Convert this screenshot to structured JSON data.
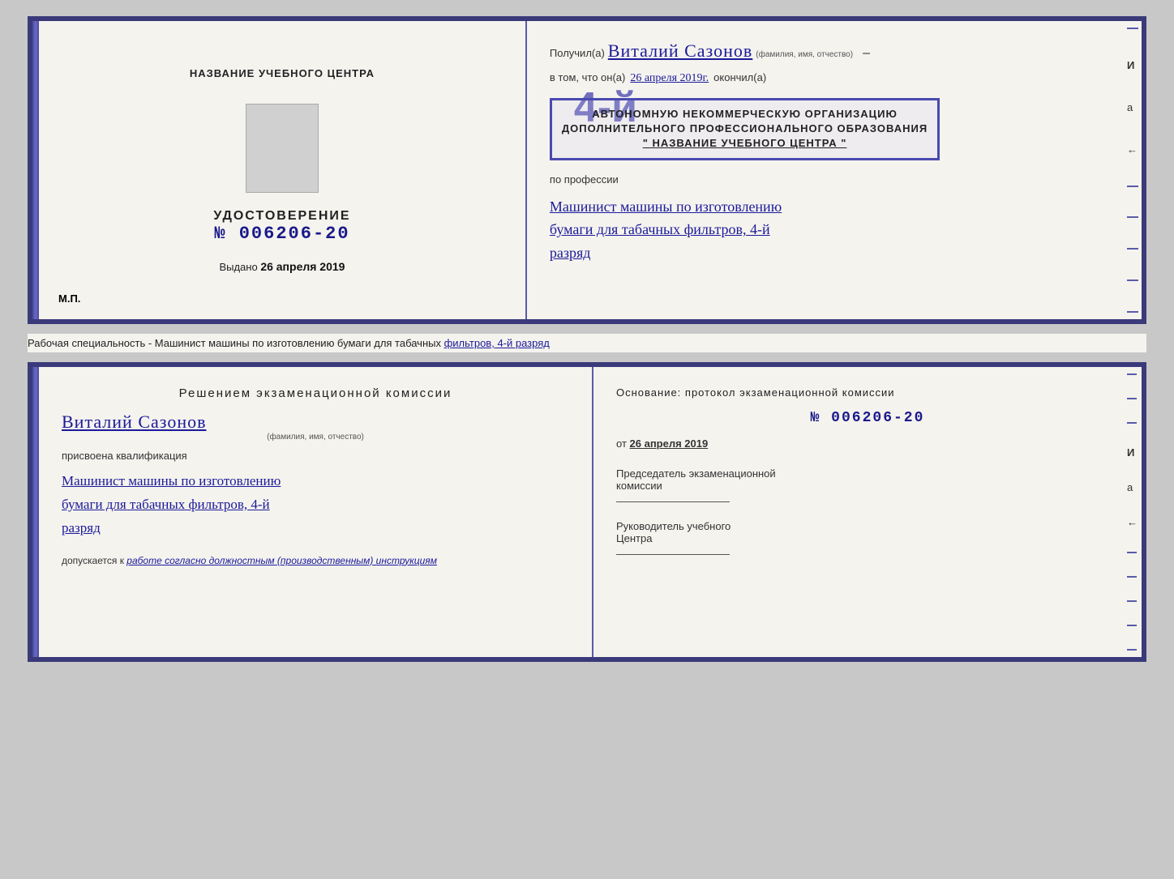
{
  "top_cert": {
    "left": {
      "header": "НАЗВАНИЕ УЧЕБНОГО ЦЕНТРА",
      "udostoverenie_label": "УДОСТОВЕРЕНИЕ",
      "number": "№ 006206-20",
      "vydano_label": "Выдано",
      "vydano_date": "26 апреля 2019",
      "mp_label": "М.П."
    },
    "right": {
      "poluchil_label": "Получил(а)",
      "recipient_name": "Виталий Сазонов",
      "fio_sublabel": "(фамилия, имя, отчество)",
      "dash": "–",
      "vtom_label": "в том, что он(а)",
      "vtom_date": "26 апреля 2019г.",
      "okonchil_label": "окончил(а)",
      "stamp_number": "4-й",
      "stamp_line1": "АВТОНОМНУЮ НЕКОММЕРЧЕСКУЮ ОРГАНИЗАЦИЮ",
      "stamp_line2": "ДОПОЛНИТЕЛЬНОГО ПРОФЕССИОНАЛЬНОГО ОБРАЗОВАНИЯ",
      "stamp_line3": "\" НАЗВАНИЕ УЧЕБНОГО ЦЕНТРА \"",
      "i_label": "И",
      "a_label": "а",
      "arrow_label": "←",
      "po_professii_label": "по профессии",
      "profession_line1": "Машинист машины по изготовлению",
      "profession_line2": "бумаги для табачных фильтров, 4-й",
      "profession_line3": "разряд"
    }
  },
  "separator": {
    "text": "Рабочая специальность - Машинист машины по изготовлению бумаги для табачных ",
    "underline_text": "фильтров, 4-й разряд"
  },
  "bottom_cert": {
    "left": {
      "reshen_title": "Решением  экзаменационной  комиссии",
      "name": "Виталий Сазонов",
      "fio_sublabel": "(фамилия, имя, отчество)",
      "prisvoena_label": "присвоена квалификация",
      "profession_line1": "Машинист машины по изготовлению",
      "profession_line2": "бумаги для табачных фильтров, 4-й",
      "profession_line3": "разряд",
      "dopusk_label": "допускается к",
      "dopusk_value": "работе согласно должностным (производственным) инструкциям"
    },
    "right": {
      "osnov_label": "Основание: протокол экзаменационной  комиссии",
      "number": "№  006206-20",
      "ot_label": "от",
      "ot_date": "26 апреля 2019",
      "predsedatel_title": "Председатель экзаменационной",
      "predsedatel_subtitle": "комиссии",
      "rukovoditel_title": "Руководитель учебного",
      "rukovoditel_subtitle": "Центра",
      "i_label": "И",
      "a_label": "а",
      "arrow_label": "←"
    }
  }
}
